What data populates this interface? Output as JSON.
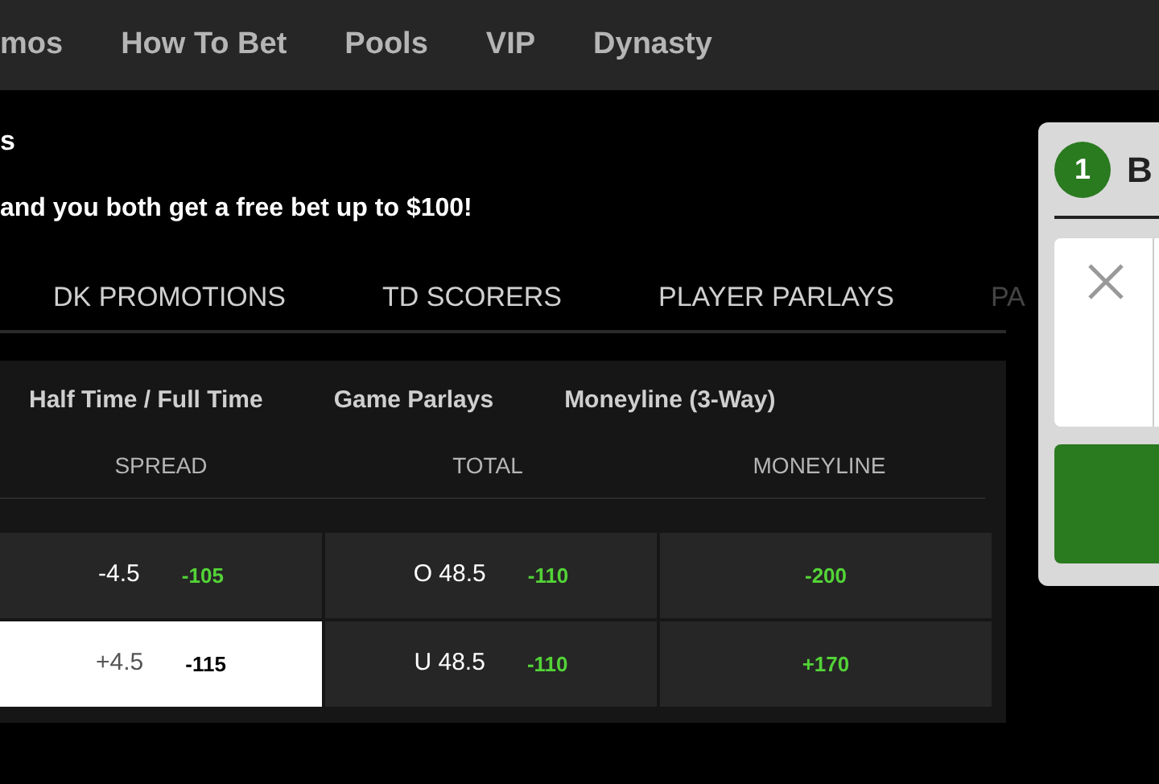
{
  "nav": {
    "items": [
      {
        "label": "mos"
      },
      {
        "label": "How To Bet"
      },
      {
        "label": "Pools"
      },
      {
        "label": "VIP"
      },
      {
        "label": "Dynasty"
      }
    ]
  },
  "promo": {
    "title": "s",
    "text": "and you both get a free bet up to $100!"
  },
  "category_tabs": [
    {
      "label": "DK PROMOTIONS",
      "faded": false
    },
    {
      "label": "TD SCORERS",
      "faded": false
    },
    {
      "label": "PLAYER PARLAYS",
      "faded": false
    },
    {
      "label": "PA",
      "faded": true
    }
  ],
  "market": {
    "subtabs": [
      {
        "label": "Half Time / Full Time"
      },
      {
        "label": "Game Parlays"
      },
      {
        "label": "Moneyline (3-Way)"
      }
    ],
    "columns": [
      "SPREAD",
      "TOTAL",
      "MONEYLINE"
    ],
    "rows": [
      {
        "cells": [
          {
            "line": "-4.5",
            "odds": "-105",
            "selected": false
          },
          {
            "line": "O 48.5",
            "odds": "-110",
            "selected": false
          },
          {
            "odds": "-200",
            "selected": false
          }
        ]
      },
      {
        "cells": [
          {
            "line": "+4.5",
            "odds": "-115",
            "selected": true
          },
          {
            "line": "U 48.5",
            "odds": "-110",
            "selected": false
          },
          {
            "odds": "+170",
            "selected": false
          }
        ]
      }
    ]
  },
  "bet_slip": {
    "count": "1",
    "title": "B"
  }
}
